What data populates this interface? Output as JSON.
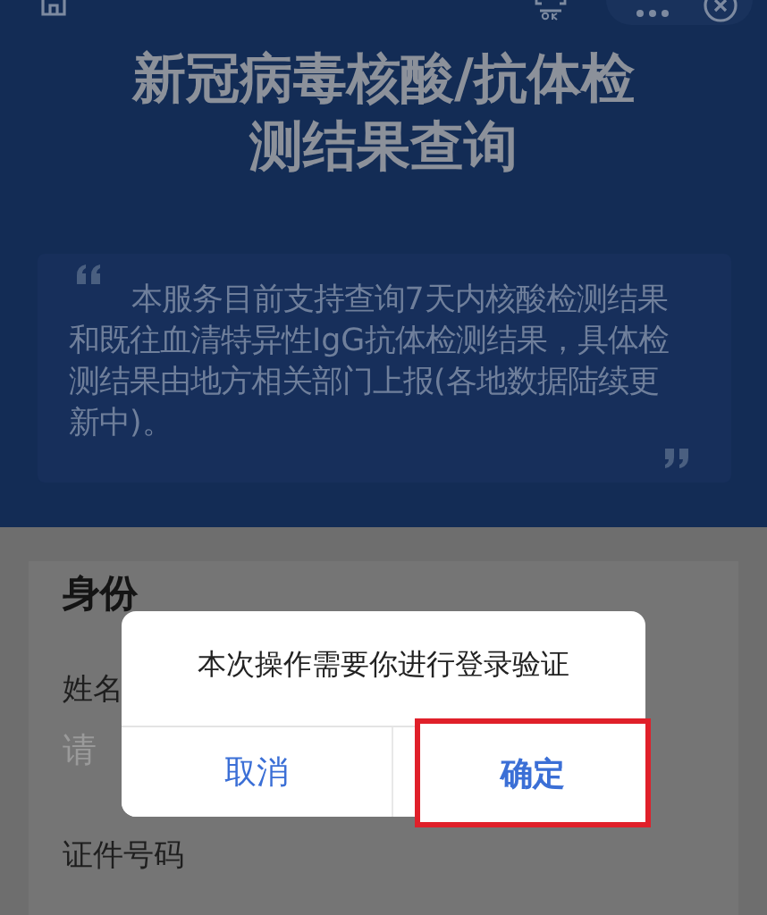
{
  "title": "新冠病毒核酸/抗体检测结果查询",
  "notice": {
    "text": "本服务目前支持查询7天内核酸检测结果和既往血清特异性IgG抗体检测结果，具体检测结果由地方相关部门上报(各地数据陆续更新中)。"
  },
  "form": {
    "section_title": "身份",
    "fields": [
      {
        "label": "姓名",
        "placeholder": "请"
      },
      {
        "label": "证件号码"
      }
    ]
  },
  "dialog": {
    "message": "本次操作需要你进行登录验证",
    "buttons": [
      {
        "label": "取消",
        "highlighted": false
      },
      {
        "label": "确定",
        "highlighted": true
      }
    ]
  }
}
